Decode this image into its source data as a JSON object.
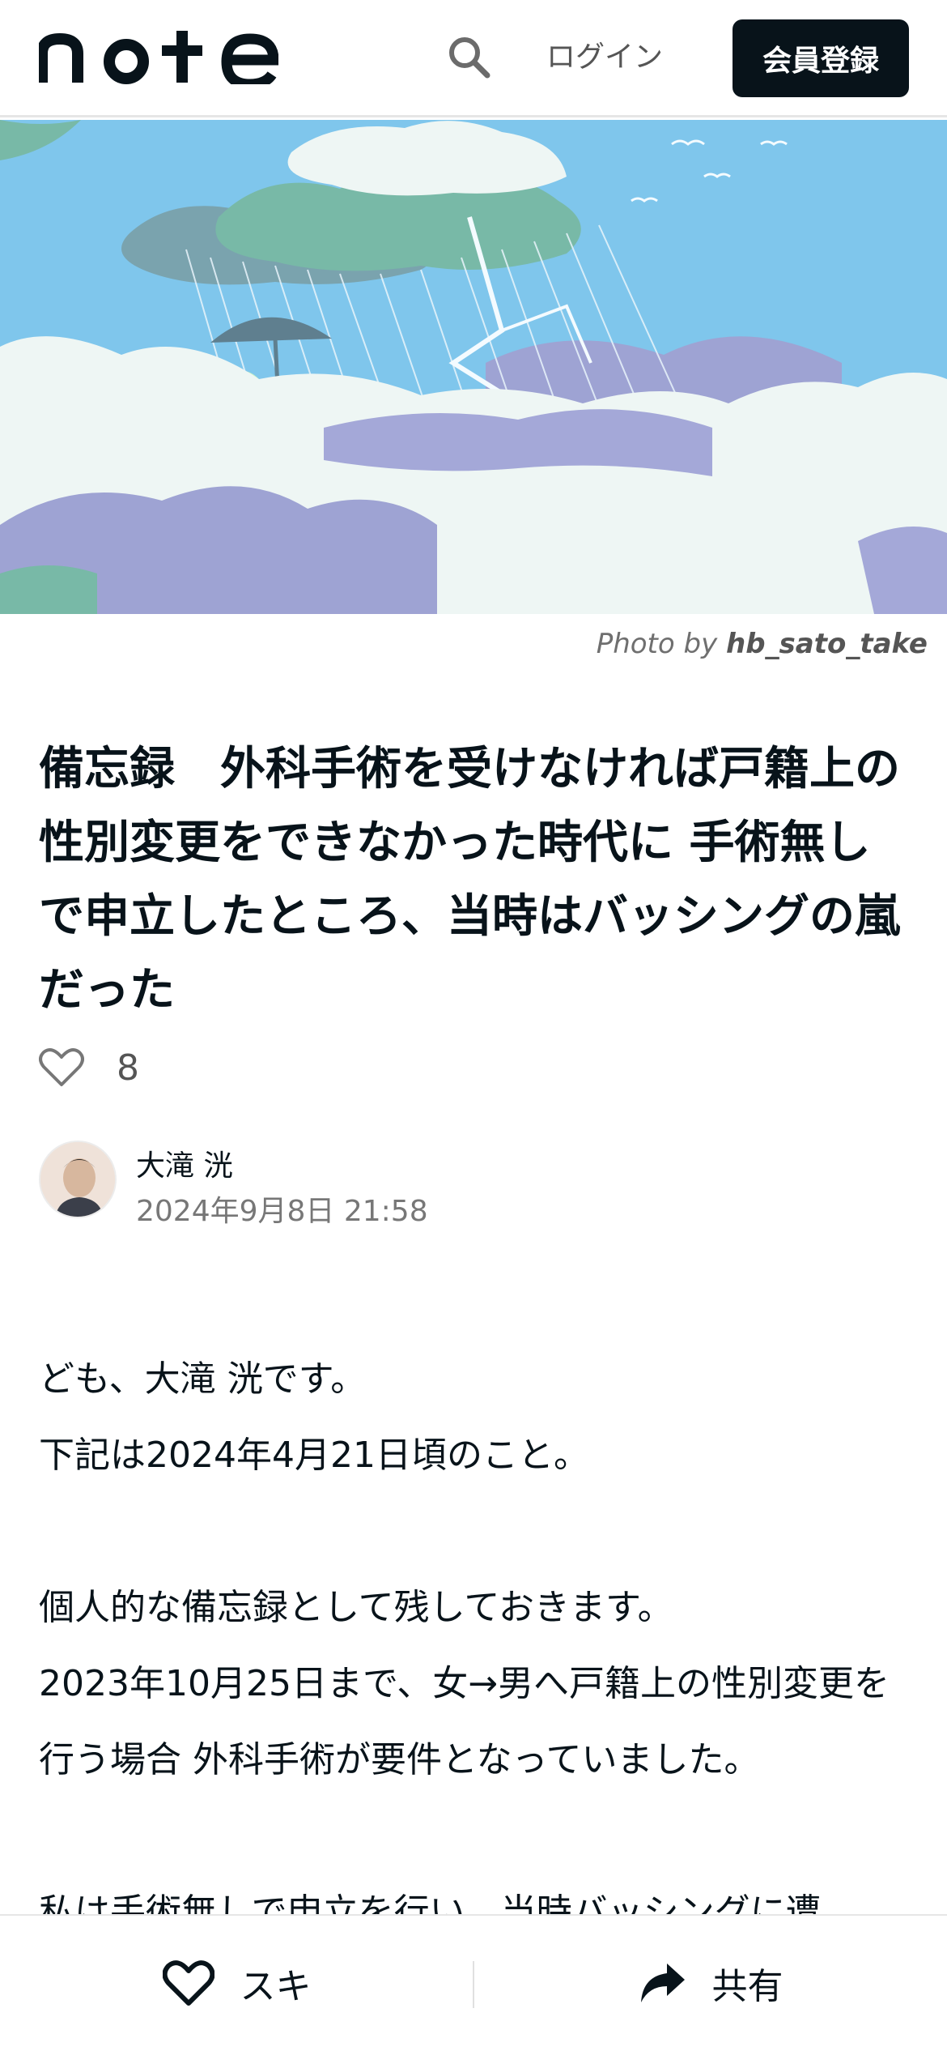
{
  "header": {
    "logo_text": "note",
    "login_label": "ログイン",
    "register_label": "会員登録"
  },
  "hero": {
    "credit_prefix": "Photo by",
    "credit_user": "hb_sato_take"
  },
  "article": {
    "title": "備忘録　外科手術を受けなければ戸籍上の性別変更をできなかった時代に 手術無しで申立したところ、当時はバッシングの嵐だった",
    "likes": "8",
    "author_name": "大滝 洸",
    "date": "2024年9月8日 21:58",
    "paragraphs": [
      "ども、大滝 洸です。",
      "下記は2024年4月21日頃のこと。",
      "",
      "個人的な備忘録として残しておきます。",
      "2023年10月25日まで、女→男へ戸籍上の性別変更を行う場合 外科手術が要件となっていました。",
      "",
      "私は手術無しで申立を行い、当時バッシングに遭"
    ]
  },
  "bottom_bar": {
    "like_label": "スキ",
    "share_label": "共有"
  },
  "colors": {
    "primary_dark": "#08131a",
    "sky": "#7fc6ec",
    "cloud": "#eef6f4",
    "lavender": "#9ea3d3"
  }
}
